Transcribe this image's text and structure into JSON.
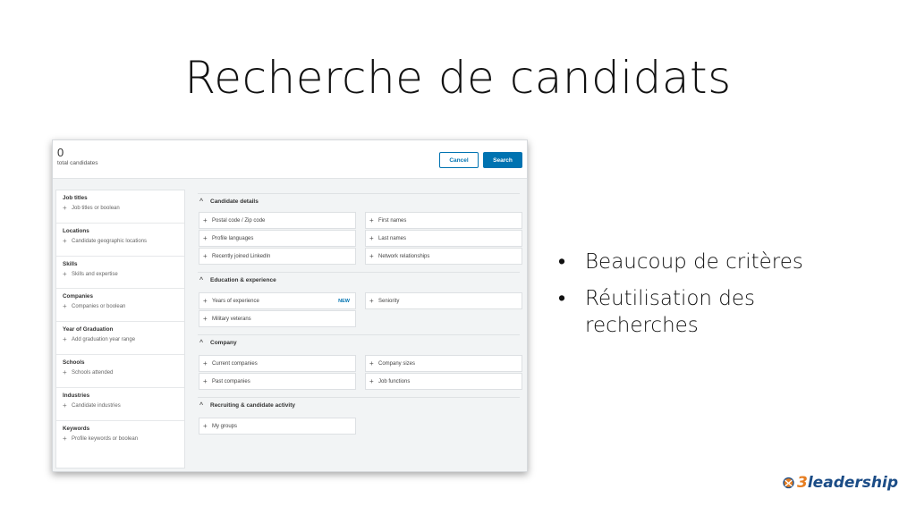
{
  "slide": {
    "title": "Recherche de candidats",
    "bullets": [
      "Beaucoup de critères",
      "Réutilisation des recherches"
    ]
  },
  "header": {
    "count": "0",
    "count_label": "total candidates",
    "cancel_label": "Cancel",
    "search_label": "Search"
  },
  "filters": [
    {
      "title": "Job titles",
      "hint": "Job titles or boolean"
    },
    {
      "title": "Locations",
      "hint": "Candidate geographic locations"
    },
    {
      "title": "Skills",
      "hint": "Skills and expertise"
    },
    {
      "title": "Companies",
      "hint": "Companies or boolean"
    },
    {
      "title": "Year of Graduation",
      "hint": "Add graduation year range"
    },
    {
      "title": "Schools",
      "hint": "Schools attended"
    },
    {
      "title": "Industries",
      "hint": "Candidate industries"
    },
    {
      "title": "Keywords",
      "hint": "Profile keywords or boolean"
    }
  ],
  "sections": {
    "candidate_details": {
      "title": "Candidate details",
      "items": [
        "Postal code / Zip code",
        "First names",
        "Profile languages",
        "Last names",
        "Recently joined LinkedIn",
        "Network relationships"
      ]
    },
    "education": {
      "title": "Education & experience",
      "items": [
        "Years of experience",
        "Seniority",
        "Military veterans"
      ],
      "badge": "NEW"
    },
    "company": {
      "title": "Company",
      "items": [
        "Current companies",
        "Company sizes",
        "Past companies",
        "Job functions"
      ]
    },
    "recruiting": {
      "title": "Recruiting & candidate activity",
      "items": [
        "My groups"
      ]
    }
  },
  "logo": {
    "prefix": "3",
    "text": "leadership"
  },
  "colors": {
    "primary": "#0073b1",
    "logo_orange": "#e67e22",
    "logo_blue": "#1b4c86"
  }
}
